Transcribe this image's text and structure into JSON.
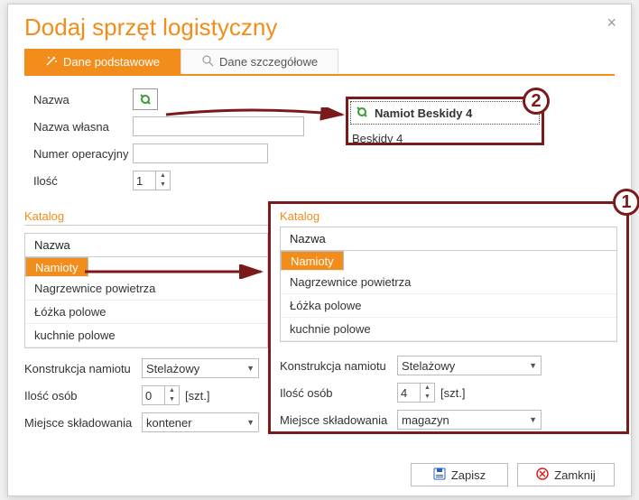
{
  "dialog": {
    "title": "Dodaj sprzęt logistyczny",
    "tabs": [
      {
        "label": "Dane podstawowe"
      },
      {
        "label": "Dane szczegółowe"
      }
    ]
  },
  "form": {
    "name_label": "Nazwa",
    "own_name_label": "Nazwa własna",
    "op_num_label": "Numer operacyjny",
    "qty_label": "Ilość",
    "qty_value": "1",
    "own_name_value": "",
    "op_num_value": ""
  },
  "annot": {
    "title": "Namiot Beskidy 4",
    "own_name": "Beskidy 4"
  },
  "katalog": {
    "label": "Katalog",
    "header": "Nazwa",
    "items": [
      "Namioty",
      "Nagrzewnice powietrza",
      "Łóżka polowe",
      "kuchnie polowe"
    ],
    "selected_index": 0
  },
  "props_left": {
    "konstr_label": "Konstrukcja namiotu",
    "konstr_value": "Stelażowy",
    "osoby_label": "Ilość osób",
    "osoby_value": "0",
    "osoby_unit": "[szt.]",
    "miejsce_label": "Miejsce składowania",
    "miejsce_value": "kontener"
  },
  "props_right": {
    "konstr_value": "Stelażowy",
    "osoby_value": "4",
    "miejsce_value": "magazyn"
  },
  "footer": {
    "save": "Zapisz",
    "close": "Zamknij"
  },
  "markers": {
    "one": "1",
    "two": "2"
  }
}
